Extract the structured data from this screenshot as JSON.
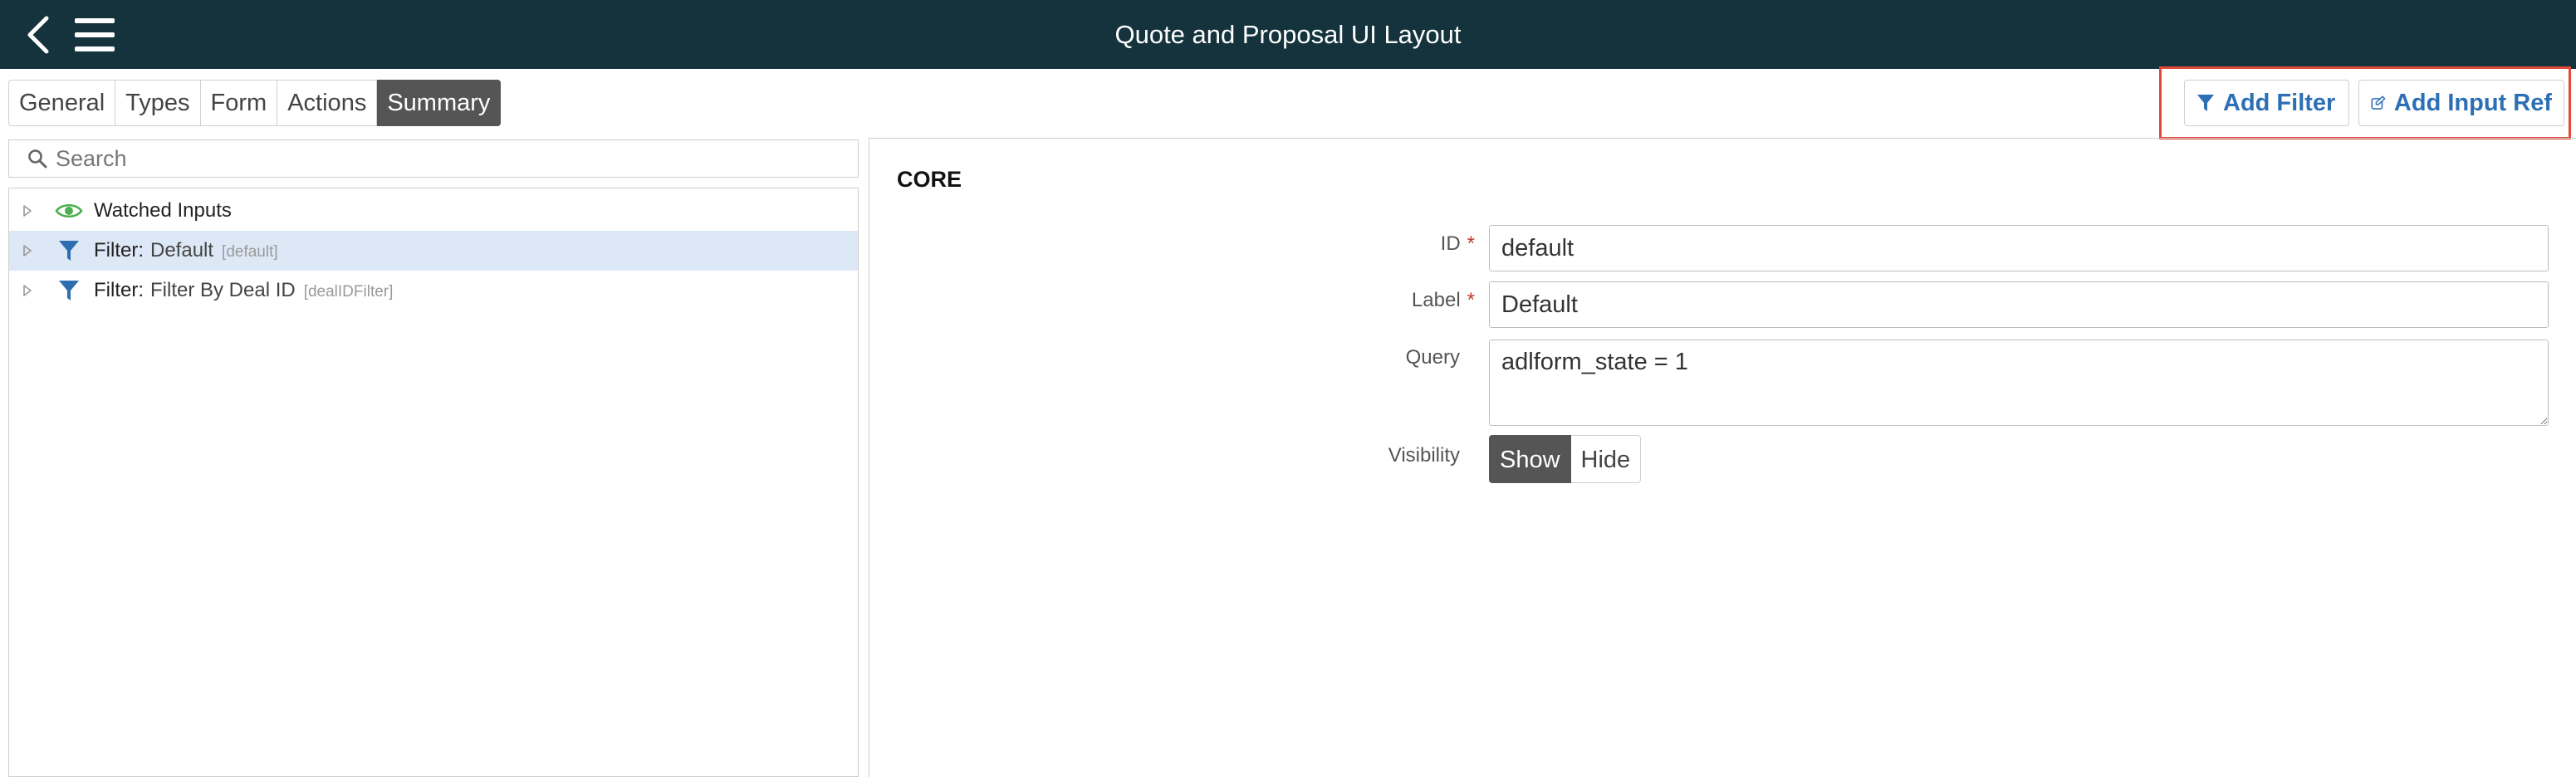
{
  "header": {
    "title": "Quote and Proposal UI Layout",
    "bg_color": "#14333d",
    "back_icon": "chevron-left-icon",
    "menu_icon": "hamburger-menu-icon"
  },
  "tabs": [
    {
      "label": "General",
      "active": false
    },
    {
      "label": "Types",
      "active": false
    },
    {
      "label": "Form",
      "active": false
    },
    {
      "label": "Actions",
      "active": false
    },
    {
      "label": "Summary",
      "active": true
    }
  ],
  "toolbar": {
    "add_filter_label": "Add Filter",
    "add_filter_icon": "filter-icon",
    "add_input_ref_label": "Add Input Ref",
    "add_input_ref_icon": "edit-icon",
    "accent_color": "#2d6fb5",
    "highlight_color": "#e0493a"
  },
  "search": {
    "placeholder": "Search",
    "value": ""
  },
  "tree": {
    "items": [
      {
        "kind": "Watched Inputs",
        "name": "",
        "key": "",
        "icon": "eye-icon",
        "selected": false
      },
      {
        "kind": "Filter:",
        "name": "Default",
        "key": "[default]",
        "icon": "filter-icon",
        "selected": true
      },
      {
        "kind": "Filter:",
        "name": "Filter By Deal ID",
        "key": "[dealIDFilter]",
        "icon": "filter-icon",
        "selected": false
      }
    ]
  },
  "detail": {
    "section_title": "CORE",
    "required_marker": "*",
    "fields": {
      "id": {
        "label": "ID",
        "value": "default"
      },
      "label": {
        "label": "Label",
        "value": "Default"
      },
      "query": {
        "label": "Query",
        "value": "adlform_state = 1"
      },
      "visibility": {
        "label": "Visibility",
        "options": [
          "Show",
          "Hide"
        ],
        "selected": "Show"
      }
    }
  }
}
